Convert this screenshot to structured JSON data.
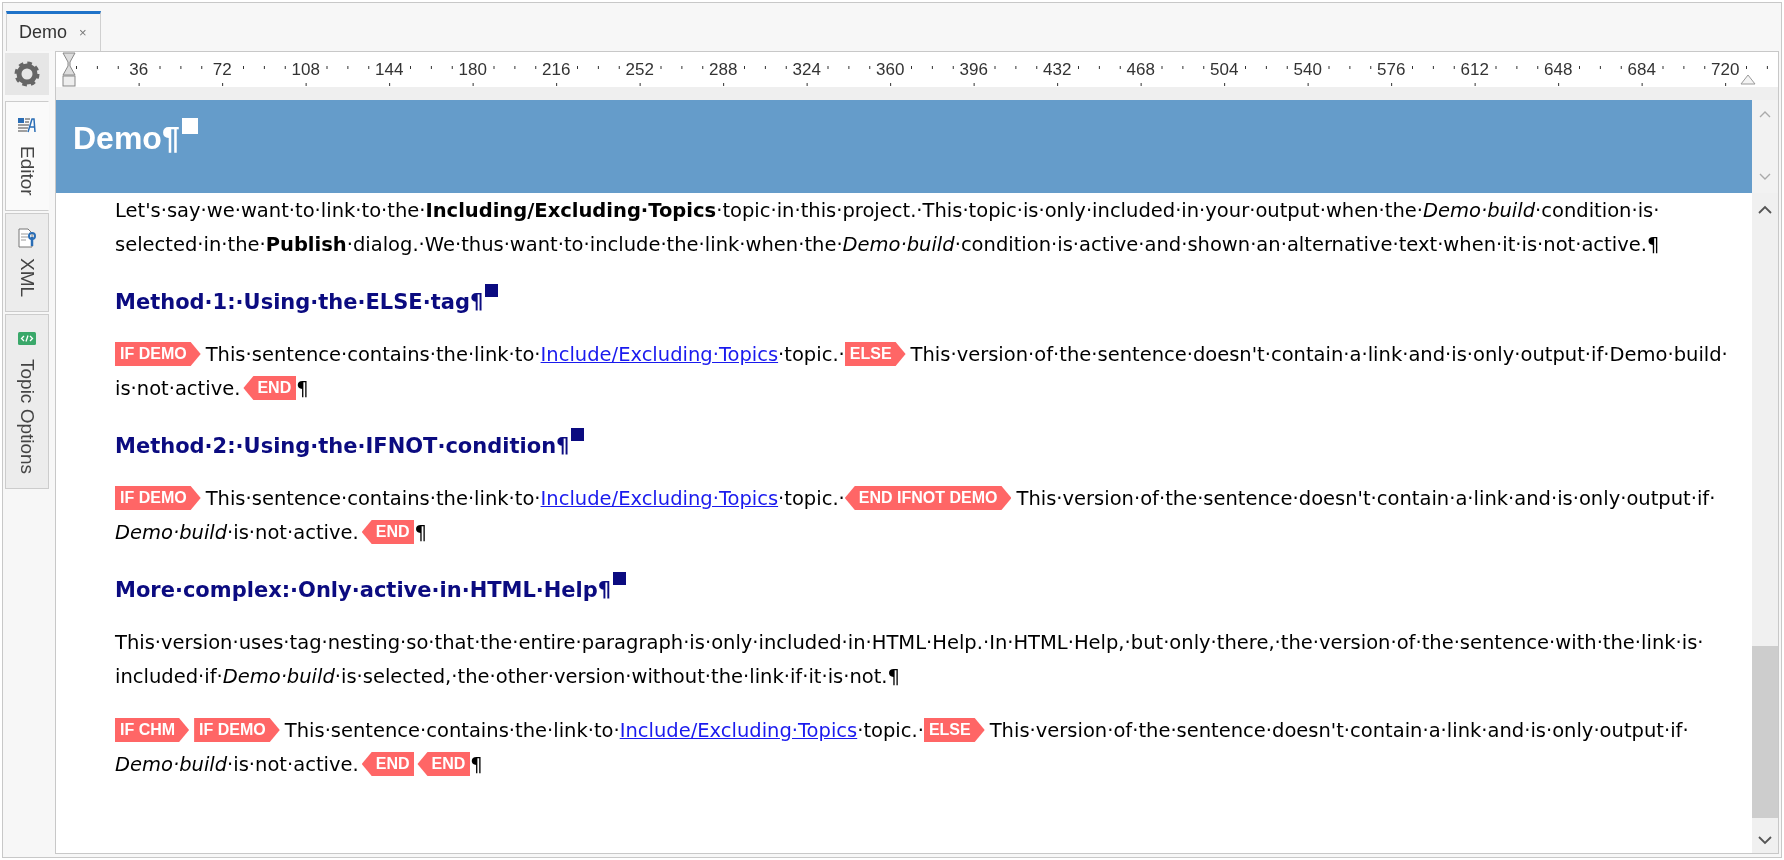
{
  "tabs": [
    {
      "label": "Demo",
      "close": "×",
      "selected": true
    }
  ],
  "sidebar": {
    "tabs": [
      {
        "label": "Editor",
        "selected": true
      },
      {
        "label": "XML",
        "selected": false
      },
      {
        "label": "Topic Options",
        "selected": false
      }
    ]
  },
  "ruler": {
    "labels": [
      "36",
      "72",
      "108",
      "144",
      "180",
      "216",
      "252",
      "288",
      "324",
      "360",
      "396",
      "432",
      "468",
      "504",
      "540",
      "576",
      "612",
      "648",
      "684",
      "720"
    ]
  },
  "document": {
    "title": "Demo¶",
    "blocks": [
      {
        "kind": "paragraph",
        "segments": [
          {
            "kind": "text",
            "text": "Let's·say·we·want·to·link·to·the·**Including/Excluding·Topics**·topic·in·this·project.·This·topic·is·only·included·in·your·output·when·the·*Demo·build*·condition·is·selected·in·the·**Publish**·dialog.·We·thus·want·to·include·the·link·when·the·*Demo·build*·condition·is·active·and·shown·an·alternative·text·when·it·is·not·active.¶"
          }
        ]
      },
      {
        "kind": "heading",
        "text": "Method·1:·Using·the·ELSE·tag¶"
      },
      {
        "kind": "paragraph",
        "segments": [
          {
            "kind": "open-tag",
            "label": "IF DEMO"
          },
          {
            "kind": "text",
            "text": "This·sentence·contains·the·link·to·"
          },
          {
            "kind": "link",
            "text": "Include/Excluding·Topics"
          },
          {
            "kind": "text",
            "text": "·topic.·"
          },
          {
            "kind": "open-tag",
            "label": "ELSE"
          },
          {
            "kind": "text",
            "text": "This·version·of·the·sentence·doesn't·contain·a·link·and·is·only·output·if·Demo·build·is·not·active."
          },
          {
            "kind": "close-tag",
            "label": "END"
          },
          {
            "kind": "text",
            "text": "¶"
          }
        ]
      },
      {
        "kind": "heading",
        "text": "Method·2:·Using·the·IFNOT·condition¶"
      },
      {
        "kind": "paragraph",
        "segments": [
          {
            "kind": "open-tag",
            "label": "IF DEMO"
          },
          {
            "kind": "text",
            "text": "This·sentence·contains·the·link·to·"
          },
          {
            "kind": "link",
            "text": "Include/Excluding·Topics"
          },
          {
            "kind": "text",
            "text": "·topic.·"
          },
          {
            "kind": "both-tag",
            "label": "END IFNOT DEMO"
          },
          {
            "kind": "text",
            "text": "This·version·of·the·sentence·doesn't·contain·a·link·and·is·only·output·if·*Demo·build*·is·not·active."
          },
          {
            "kind": "close-tag",
            "label": "END"
          },
          {
            "kind": "text",
            "text": "¶"
          }
        ]
      },
      {
        "kind": "heading",
        "text": "More·complex:·Only·active·in·HTML·Help¶"
      },
      {
        "kind": "paragraph",
        "segments": [
          {
            "kind": "text",
            "text": "This·version·uses·tag·nesting·so·that·the·entire·paragraph·is·only·included·in·HTML·Help.·In·HTML·Help,·but·only·there,·the·version·of·the·sentence·with·the·link·is·included·if·*Demo·build*·is·selected,·the·other·version·without·the·link·if·it·is·not.¶"
          }
        ]
      },
      {
        "kind": "paragraph",
        "segments": [
          {
            "kind": "open-tag",
            "label": "IF CHM"
          },
          {
            "kind": "open-tag",
            "label": "IF DEMO"
          },
          {
            "kind": "text",
            "text": "This·sentence·contains·the·link·to·"
          },
          {
            "kind": "link",
            "text": "Include/Excluding·Topics"
          },
          {
            "kind": "text",
            "text": "·topic.·"
          },
          {
            "kind": "open-tag",
            "label": "ELSE"
          },
          {
            "kind": "text",
            "text": "This·version·of·the·sentence·doesn't·contain·a·link·and·is·only·output·if·*Demo·build*·is·not·active."
          },
          {
            "kind": "close-tag",
            "label": "END"
          },
          {
            "kind": "close-tag",
            "label": "END"
          },
          {
            "kind": "text",
            "text": "¶"
          }
        ]
      }
    ]
  }
}
